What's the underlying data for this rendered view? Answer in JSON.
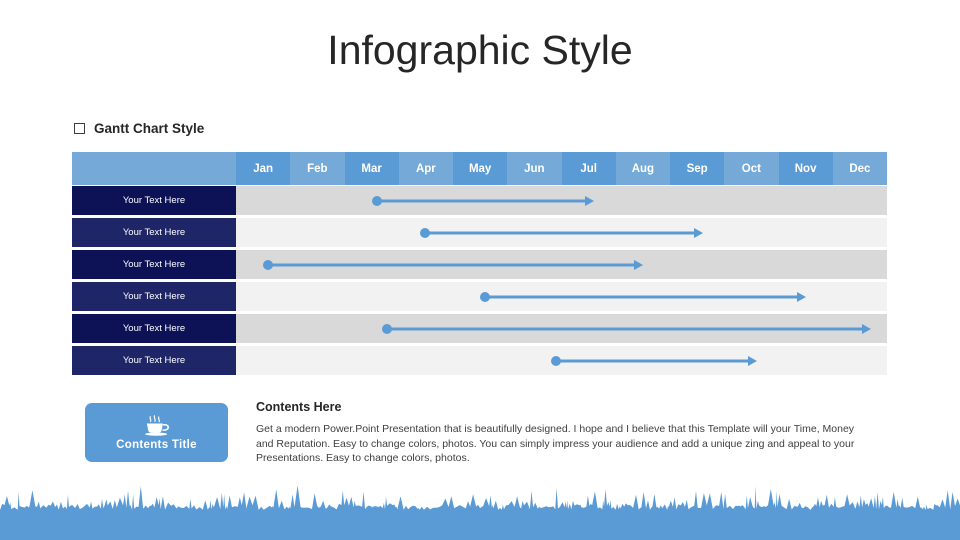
{
  "slide": {
    "title": "Infographic Style"
  },
  "section": {
    "bullet_icon": "hollow-square-bullet-icon",
    "label": "Gantt Chart Style"
  },
  "colors": {
    "accent_blue": "#5b9bd5",
    "accent_blue_light": "#74a9d8",
    "label_navy": "#0d1257",
    "label_navy_alt": "#1f2668",
    "row_gray": "#d9d9d9",
    "row_gray_light": "#f2f2f2",
    "title_text": "#262626"
  },
  "gantt": {
    "months": [
      "Jan",
      "Feb",
      "Mar",
      "Apr",
      "May",
      "Jun",
      "Jul",
      "Aug",
      "Sep",
      "Oct",
      "Nov",
      "Dec"
    ],
    "rows": [
      {
        "label": "Your Text Here",
        "start_month": 3.5,
        "end_month": 7.6
      },
      {
        "label": "Your Text Here",
        "start_month": 4.4,
        "end_month": 9.6
      },
      {
        "label": "Your Text Here",
        "start_month": 1.5,
        "end_month": 8.5
      },
      {
        "label": "Your Text Here",
        "start_month": 5.5,
        "end_month": 11.5
      },
      {
        "label": "Your Text Here",
        "start_month": 3.7,
        "end_month": 12.7
      },
      {
        "label": "Your Text Here",
        "start_month": 6.8,
        "end_month": 10.6
      }
    ]
  },
  "contents": {
    "card": {
      "icon": "coffee-cup-icon",
      "title": "Contents Title"
    },
    "heading": "Contents Here",
    "body": "Get a modern Power.Point  Presentation that is beautifully designed. I hope and I believe that this Template will your Time, Money and Reputation. Easy to change colors, photos. You can simply impress your audience and add a unique zing and appeal to your Presentations. Easy to change colors, photos."
  },
  "decoration": {
    "grass_band": "blue-grass-silhouette"
  }
}
